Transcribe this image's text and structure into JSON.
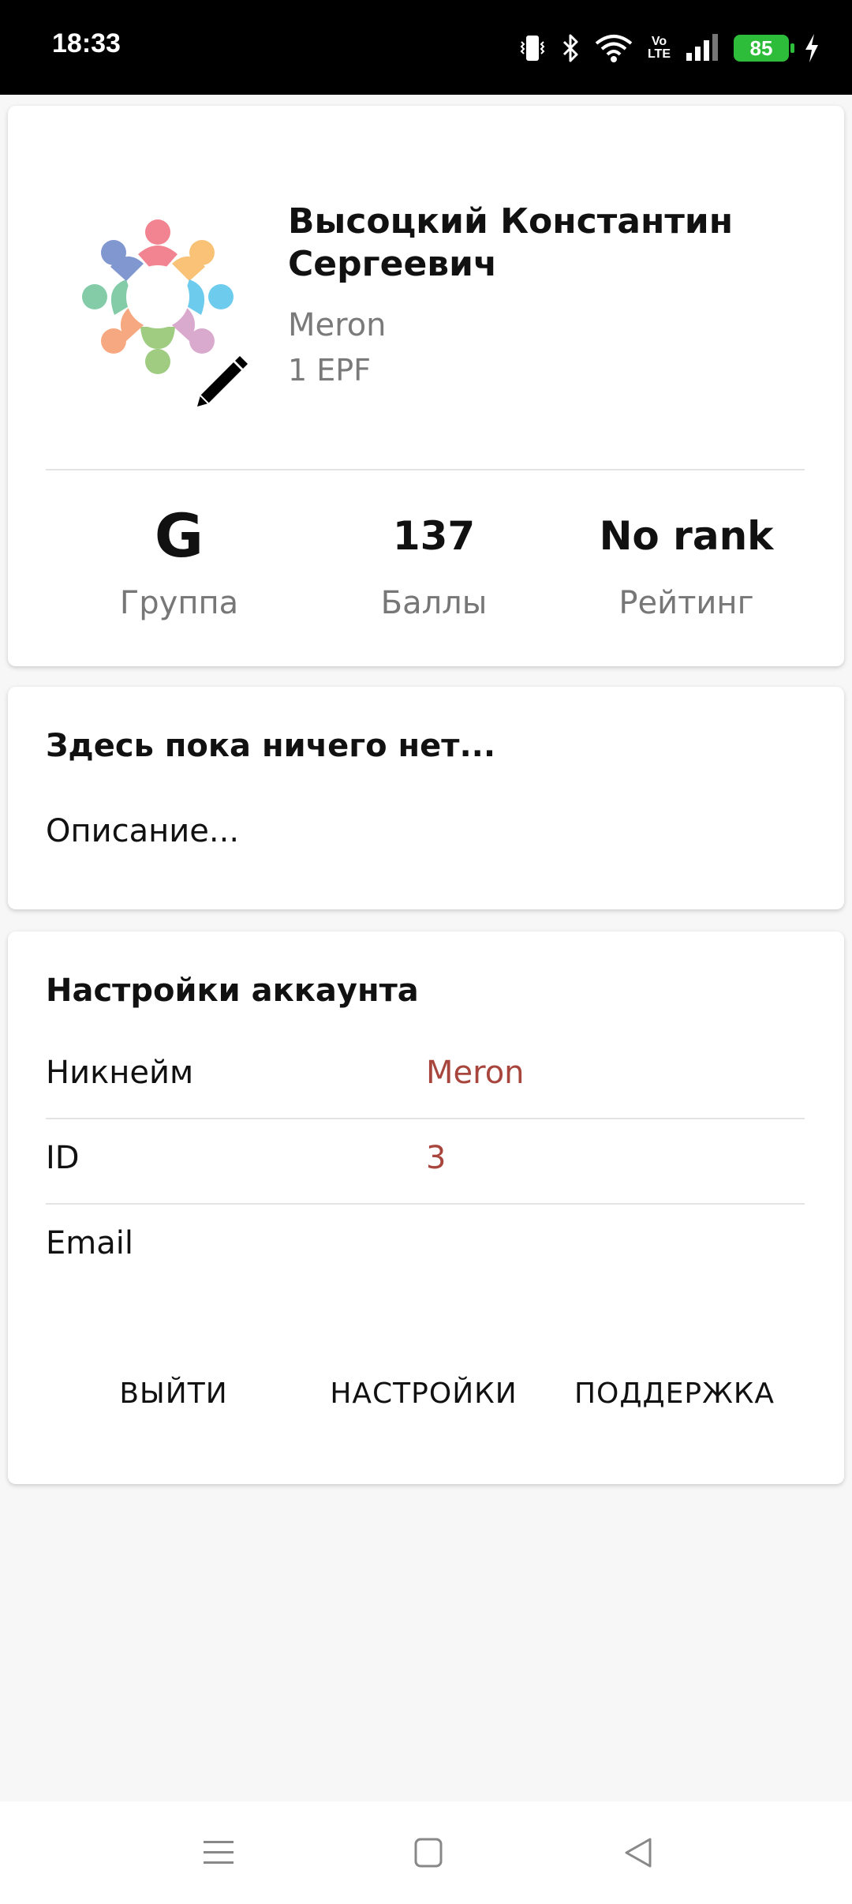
{
  "status_bar": {
    "time": "18:33",
    "battery": "85",
    "volte": [
      "Vo",
      "LTE"
    ]
  },
  "profile": {
    "full_name": "Высоцкий Константин Сергеевич",
    "nickname": "Meron",
    "class": "1 EPF",
    "stats": [
      {
        "value": "G",
        "label": "Группа"
      },
      {
        "value": "137",
        "label": "Баллы"
      },
      {
        "value": "No rank",
        "label": "Рейтинг"
      }
    ]
  },
  "description": {
    "title": "Здесь пока ничего нет...",
    "text": "Описание..."
  },
  "account": {
    "title": "Настройки аккаунта",
    "rows": [
      {
        "label": "Никнейм",
        "value": "Meron"
      },
      {
        "label": "ID",
        "value": "3"
      },
      {
        "label": "Email",
        "value": ""
      }
    ],
    "actions": {
      "logout": "ВЫЙТИ",
      "settings": "НАСТРОЙКИ",
      "support": "ПОДДЕРЖКА"
    }
  },
  "colors": {
    "accent_value": "#a8463e",
    "battery": "#2dbd3a"
  },
  "icons": {
    "avatar": "people-circle-logo",
    "edit": "pencil-icon",
    "nav": [
      "menu-icon",
      "home-square-icon",
      "back-triangle-icon"
    ]
  }
}
